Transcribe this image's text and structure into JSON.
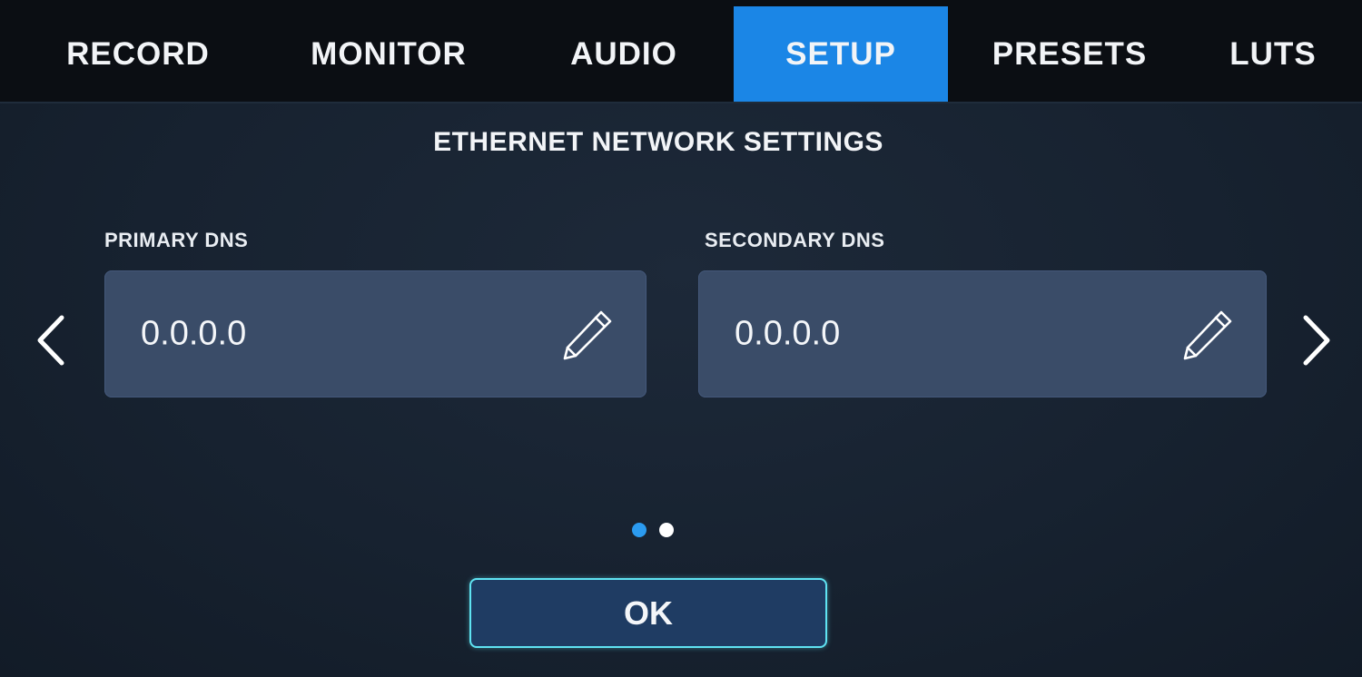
{
  "tabs": [
    {
      "label": "RECORD",
      "active": false
    },
    {
      "label": "MONITOR",
      "active": false
    },
    {
      "label": "AUDIO",
      "active": false
    },
    {
      "label": "SETUP",
      "active": true
    },
    {
      "label": "PRESETS",
      "active": false
    },
    {
      "label": "LUTS",
      "active": false
    }
  ],
  "section": {
    "title": "ETHERNET NETWORK SETTINGS"
  },
  "fields": {
    "primary_dns": {
      "label": "PRIMARY DNS",
      "value": "0.0.0.0",
      "icon": "pencil-icon"
    },
    "secondary_dns": {
      "label": "SECONDARY DNS",
      "value": "0.0.0.0",
      "icon": "pencil-icon"
    }
  },
  "pagination": {
    "total_pages": 2,
    "current_page": 1
  },
  "actions": {
    "ok_label": "OK"
  },
  "colors": {
    "tab_active": "#1b86e6",
    "field_bg": "#3a4c68",
    "ok_border": "#5fe3f2",
    "dot_active": "#2b9bf0"
  }
}
